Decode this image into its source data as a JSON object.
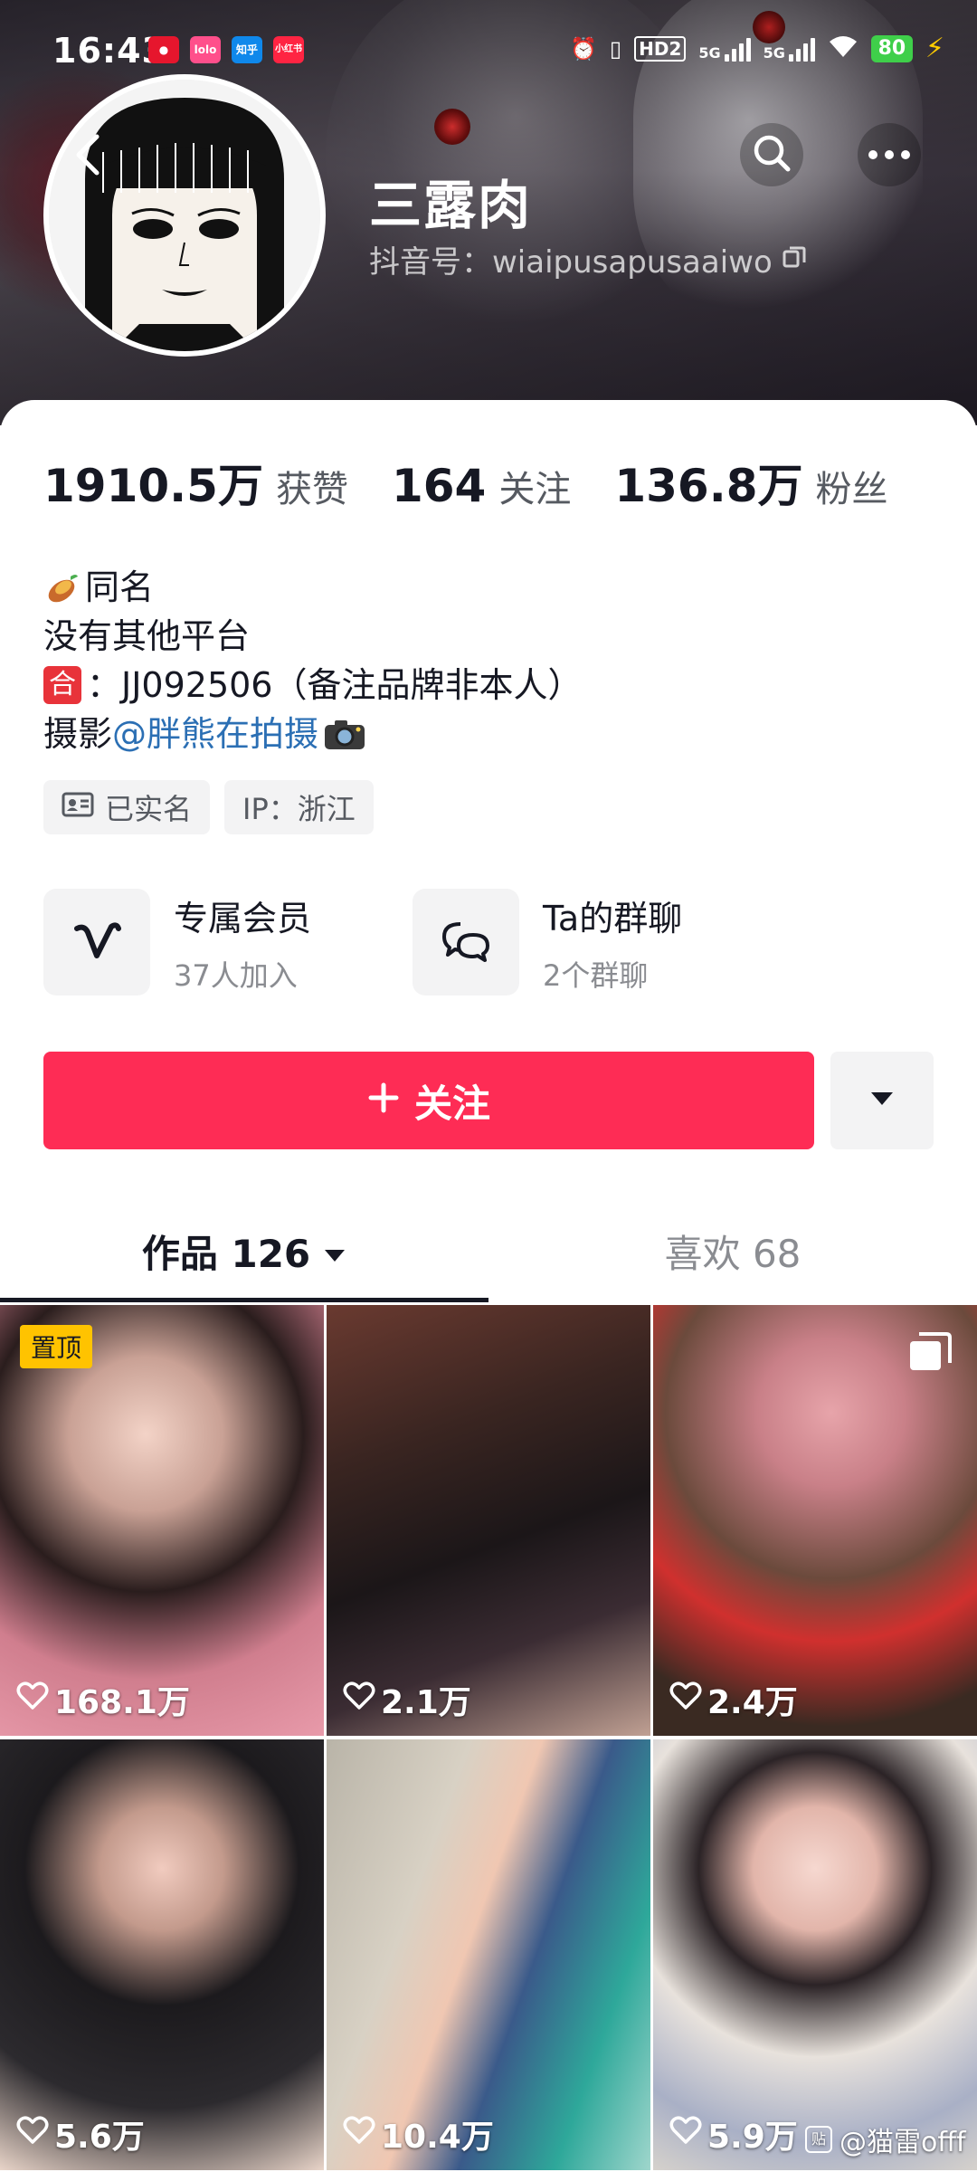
{
  "status_bar": {
    "time": "16:43",
    "app_icons": [
      "weibo",
      "lolo",
      "知乎",
      "小红书"
    ],
    "network_labels": [
      "HD2",
      "5G",
      "5G"
    ],
    "battery": "80"
  },
  "header": {
    "name": "三露肉",
    "douyin_id": "抖音号：wiaipusapusaaiwo"
  },
  "stats": [
    {
      "value": "1910.5万",
      "label": "获赞"
    },
    {
      "value": "164",
      "label": "关注"
    },
    {
      "value": "136.8万",
      "label": "粉丝"
    }
  ],
  "bio": {
    "line1": "同名",
    "line2": "没有其他平台",
    "line3_icon": "合",
    "line3": "：JJ092506（备注品牌非本人）",
    "line4_prefix": "摄影",
    "line4_mention": "@胖熊在拍摄"
  },
  "tags": [
    {
      "icon": "id-card-icon",
      "label": "已实名"
    },
    {
      "icon": "",
      "label": "IP：浙江"
    }
  ],
  "features": [
    {
      "title": "专属会员",
      "subtitle": "37人加入"
    },
    {
      "title": "Ta的群聊",
      "subtitle": "2个群聊"
    }
  ],
  "follow_button": "关注",
  "tabs": {
    "works": "作品 126",
    "likes": "喜欢 68"
  },
  "videos": [
    {
      "likes": "168.1万",
      "pinned": "置顶"
    },
    {
      "likes": "2.1万"
    },
    {
      "likes": "2.4万",
      "multi": true
    },
    {
      "likes": "5.6万"
    },
    {
      "likes": "10.4万"
    },
    {
      "likes": "5.9万"
    }
  ],
  "watermark": "@猫雷offf",
  "colors": {
    "follow": "#fe2c55",
    "mention": "#2b6fb4",
    "pin": "#ffc300",
    "battery": "#3fcf4a"
  }
}
